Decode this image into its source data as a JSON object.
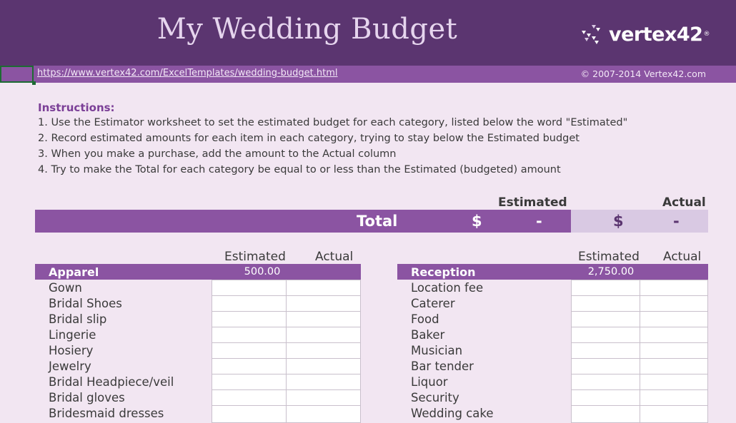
{
  "header": {
    "title": "My Wedding Budget",
    "logo_text": "vertex42",
    "logo_reg": "®"
  },
  "linkbar": {
    "link": "https://www.vertex42.com/ExcelTemplates/wedding-budget.html",
    "copyright": "© 2007-2014 Vertex42.com"
  },
  "instructions": {
    "heading": "Instructions:",
    "lines": [
      "1. Use the Estimator worksheet to set the estimated budget for each category, listed below the word \"Estimated\"",
      "2. Record estimated amounts for each item in each category, trying to stay below the Estimated budget",
      "3. When you make a purchase, add the amount to the Actual column",
      "4. Try to make the Total for each category be equal to or less than the Estimated (budgeted) amount"
    ]
  },
  "totals": {
    "estimated_header": "Estimated",
    "actual_header": "Actual",
    "label": "Total",
    "currency": "$",
    "estimated_value": "-",
    "actual_value": "-"
  },
  "categories": [
    {
      "estimated_header": "Estimated",
      "actual_header": "Actual",
      "name": "Apparel",
      "estimated": "500.00",
      "items": [
        "Gown",
        "Bridal Shoes",
        "Bridal slip",
        "Lingerie",
        "Hosiery",
        "Jewelry",
        "Bridal Headpiece/veil",
        "Bridal gloves",
        "Bridesmaid dresses"
      ]
    },
    {
      "estimated_header": "Estimated",
      "actual_header": "Actual",
      "name": "Reception",
      "estimated": "2,750.00",
      "items": [
        "Location fee",
        "Caterer",
        "Food",
        "Baker",
        "Musician",
        "Bar tender",
        "Liquor",
        "Security",
        "Wedding cake"
      ]
    }
  ],
  "colors": {
    "banner": "#5b3570",
    "accent": "#8b54a2",
    "background": "#f2e6f2",
    "heading": "#7b3f97"
  }
}
